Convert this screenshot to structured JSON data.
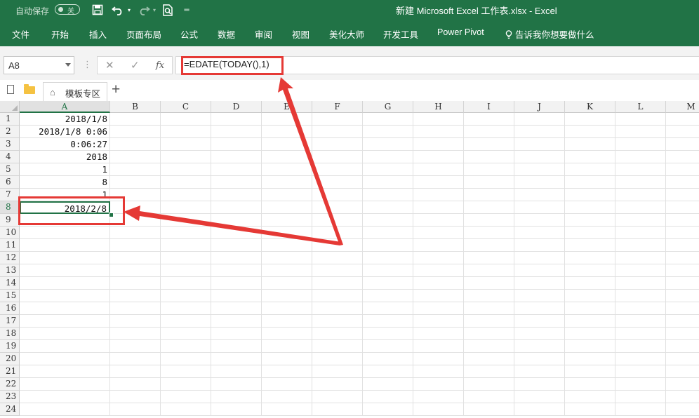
{
  "titlebar": {
    "autosave_label": "自动保存",
    "autosave_toggle": "关",
    "title": "新建 Microsoft Excel 工作表.xlsx  -  Excel"
  },
  "menu": [
    "文件",
    "开始",
    "插入",
    "页面布局",
    "公式",
    "数据",
    "审阅",
    "视图",
    "美化大师",
    "开发工具",
    "Power Pivot",
    "告诉我你想要做什么"
  ],
  "formula_bar": {
    "name_box": "A8",
    "cancel_glyph": "✕",
    "enter_glyph": "✓",
    "fx_glyph": "fx",
    "formula": "=EDATE(TODAY(),1)"
  },
  "tabs": {
    "template_tab": "模板专区",
    "add_glyph": "+"
  },
  "grid": {
    "columns": [
      "A",
      "B",
      "C",
      "D",
      "E",
      "F",
      "G",
      "H",
      "I",
      "J",
      "K",
      "L",
      "M"
    ],
    "rows": [
      "1",
      "2",
      "3",
      "4",
      "5",
      "6",
      "7",
      "8",
      "9",
      "10",
      "11",
      "12",
      "13",
      "14",
      "15",
      "16",
      "17",
      "18",
      "19",
      "20",
      "21",
      "22",
      "23",
      "24"
    ],
    "column_a_values": [
      "2018/1/8",
      "2018/1/8 0:06",
      "0:06:27",
      "2018",
      "1",
      "8",
      "1",
      "2018/2/8",
      "",
      "",
      "",
      "",
      "",
      "",
      "",
      "",
      "",
      "",
      "",
      "",
      "",
      "",
      "",
      ""
    ],
    "active_cell": "A8"
  },
  "colors": {
    "ribbon": "#217346",
    "highlight": "#e53935"
  }
}
